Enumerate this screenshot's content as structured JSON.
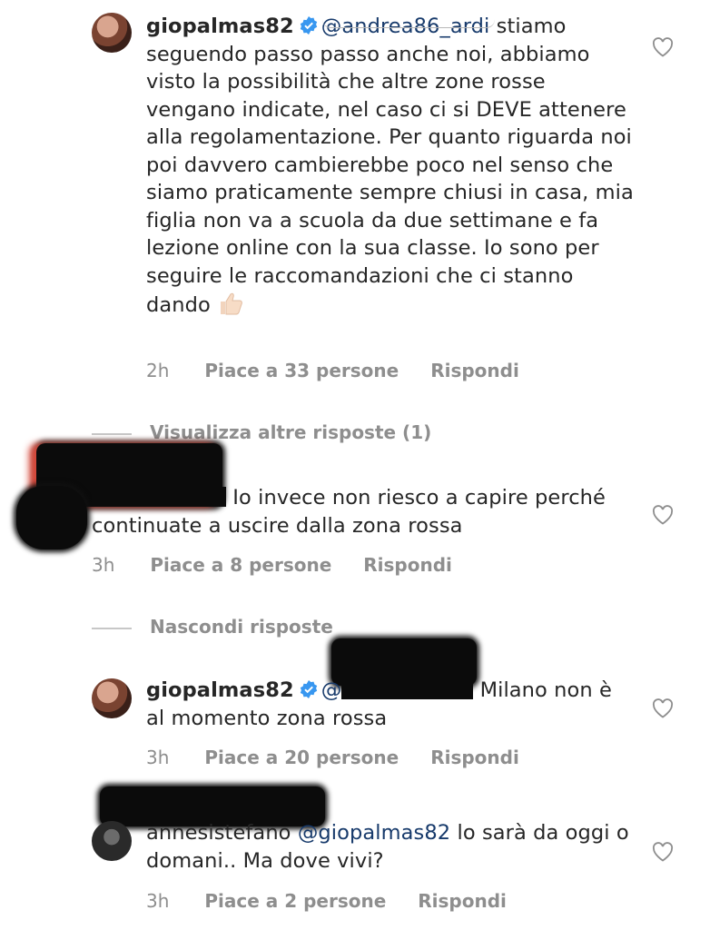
{
  "comments": [
    {
      "username": "giopalmas82",
      "mention": "@andrea86_ardi",
      "text": " stiamo seguendo passo passo anche noi, abbiamo visto la possibilità che altre zone rosse vengano indicate, nel caso ci si DEVE attenere alla regolamentazione. Per quanto riguarda noi poi davvero cambierebbe poco nel senso che siamo praticamente sempre chiusi in casa, mia figlia non va a scuola da due settimane e fa lezione online con la sua classe. Io sono per seguire le raccomandazioni che ci stanno dando",
      "emoji": "thumbs-up",
      "time": "2h",
      "likes": "Piace a 33 persone",
      "reply": "Rispondi"
    },
    {
      "username": "",
      "text": " Io invece non riesco a capire perché  continuate a uscire dalla zona rossa",
      "time": "3h",
      "likes": "Piace a 8 persone",
      "reply": "Rispondi"
    },
    {
      "username": "giopalmas82",
      "mention": "@",
      "text": " Milano non è al momento zona rossa",
      "time": "3h",
      "likes": "Piace a 20 persone",
      "reply": "Rispondi"
    },
    {
      "username": "annesistefano",
      "mention": "@giopalmas82",
      "text": " lo sarà da oggi o domani.. Ma dove vivi?",
      "time": "3h",
      "likes": "Piace a 2 persone",
      "reply": "Rispondi"
    }
  ],
  "toggles": {
    "view_more": "Visualizza altre risposte (1)",
    "hide": "Nascondi risposte"
  },
  "colors": {
    "text": "#262626",
    "meta": "#8e8e8e",
    "mention": "#173a6b",
    "verified": "#3897f0"
  },
  "icons": [
    "verified-badge-icon",
    "heart-icon",
    "thumbs-up-emoji"
  ]
}
